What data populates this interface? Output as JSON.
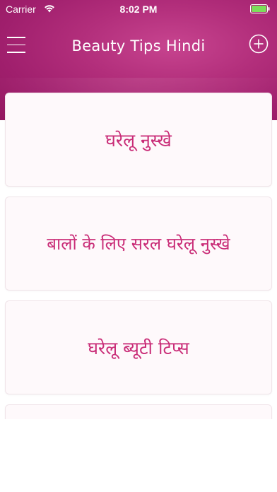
{
  "status_bar": {
    "carrier": "Carrier",
    "time": "8:02 PM",
    "wifi_icon": "wifi-icon",
    "battery_icon": "battery-icon"
  },
  "header": {
    "title": "Beauty Tips Hindi",
    "menu_icon": "hamburger-menu-icon",
    "add_icon": "plus-circle-icon",
    "gradient_color": "#a8246f"
  },
  "categories": [
    {
      "label": "घरेलू नुस्खे"
    },
    {
      "label": "बालों के लिए सरल घरेलू नुस्खे"
    },
    {
      "label": "घरेलू ब्यूटी टिप्स"
    },
    {
      "label": ""
    }
  ],
  "colors": {
    "accent": "#c92c77",
    "card_background": "#fef9fb",
    "card_border": "#f0e4e9"
  }
}
